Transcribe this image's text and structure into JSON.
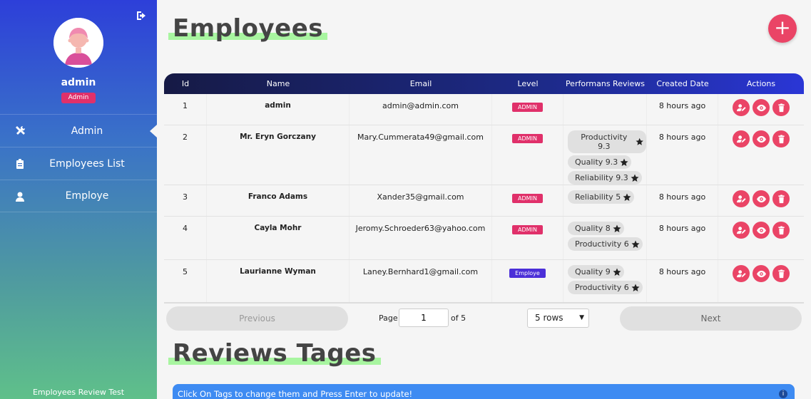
{
  "sidebar": {
    "user": {
      "name": "admin",
      "role": "Admin"
    },
    "items": [
      {
        "label": "Admin",
        "icon": "tools-icon",
        "active": true
      },
      {
        "label": "Employees List",
        "icon": "clipboard-icon",
        "active": false
      },
      {
        "label": "Employe",
        "icon": "user-icon",
        "active": false
      }
    ],
    "footer": "Employees Review Test"
  },
  "employees_title": "Employees",
  "add_button": "+",
  "table": {
    "headers": [
      "Id",
      "Name",
      "Email",
      "Level",
      "Performans Reviews",
      "Created Date",
      "Actions"
    ],
    "rows": [
      {
        "id": "1",
        "name": "admin",
        "email": "admin@admin.com",
        "level": "ADMIN",
        "reviews": [],
        "created": "8 hours ago"
      },
      {
        "id": "2",
        "name": "Mr. Eryn Gorczany",
        "email": "Mary.Cummerata49@gmail.com",
        "level": "ADMIN",
        "reviews": [
          "Productivity 9.3",
          "Quality 9.3",
          "Reliability 9.3"
        ],
        "created": "8 hours ago"
      },
      {
        "id": "3",
        "name": "Franco Adams",
        "email": "Xander35@gmail.com",
        "level": "ADMIN",
        "reviews": [
          "Reliability 5"
        ],
        "created": "8 hours ago"
      },
      {
        "id": "4",
        "name": "Cayla Mohr",
        "email": "Jeromy.Schroeder63@yahoo.com",
        "level": "ADMIN",
        "reviews": [
          "Quality 8",
          "Productivity 6"
        ],
        "created": "8 hours ago"
      },
      {
        "id": "5",
        "name": "Laurianne Wyman",
        "email": "Laney.Bernhard1@gmail.com",
        "level": "Employe",
        "reviews": [
          "Quality 9",
          "Productivity 6"
        ],
        "created": "8 hours ago"
      }
    ]
  },
  "pagination": {
    "previous": "Previous",
    "page_label": "Page",
    "page_value": "1",
    "of_label": "of 5",
    "rows_option": "5 rows",
    "next": "Next"
  },
  "reviews_title": "Reviews Tages",
  "info_message": "Click On Tags to change them and Press Enter to update!",
  "colors": {
    "accent": "#ea4466",
    "admin_badge": "#e0306a",
    "employe_badge": "#4b2fd8",
    "highlight": "#a8f5a0",
    "info": "#3e8bf2"
  }
}
